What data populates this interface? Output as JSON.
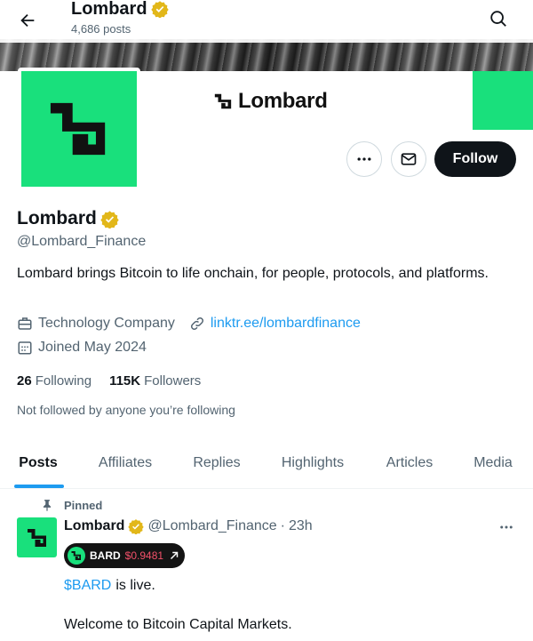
{
  "header": {
    "title": "Lombard",
    "post_count": "4,686 posts",
    "icons": {
      "back": "arrow-left-icon",
      "search": "search-icon",
      "verified": "verified-badge-icon"
    }
  },
  "banner": {
    "logo_text": "Lombard",
    "brand_color": "#19e07c"
  },
  "actions": {
    "more_icon": "more-horizontal-icon",
    "message_icon": "mail-icon",
    "follow_label": "Follow"
  },
  "profile": {
    "name": "Lombard",
    "handle": "@Lombard_Finance",
    "bio": "Lombard brings Bitcoin to life onchain, for people, protocols, and platforms.",
    "category": "Technology Company",
    "link": "linktr.ee/lombardfinance",
    "joined": "Joined May 2024",
    "following_count": "26",
    "following_label": "Following",
    "followers_count": "115K",
    "followers_label": "Followers",
    "not_followed": "Not followed by anyone you’re following"
  },
  "tabs": [
    {
      "label": "Posts",
      "active": true
    },
    {
      "label": "Affiliates",
      "active": false
    },
    {
      "label": "Replies",
      "active": false
    },
    {
      "label": "Highlights",
      "active": false
    },
    {
      "label": "Articles",
      "active": false
    },
    {
      "label": "Media",
      "active": false
    }
  ],
  "post": {
    "pinned_label": "Pinned",
    "author_name": "Lombard",
    "author_handle": "@Lombard_Finance",
    "separator": "·",
    "time": "23h",
    "token": {
      "symbol": "BARD",
      "price": "$0.9481",
      "price_color": "#f4516a"
    },
    "cashtag": "$BARD",
    "line1_rest": "is live.",
    "line2": "Welcome to Bitcoin Capital Markets."
  },
  "colors": {
    "accent": "#1d9bf0",
    "text_primary": "#0f1419",
    "text_secondary": "#536471"
  }
}
